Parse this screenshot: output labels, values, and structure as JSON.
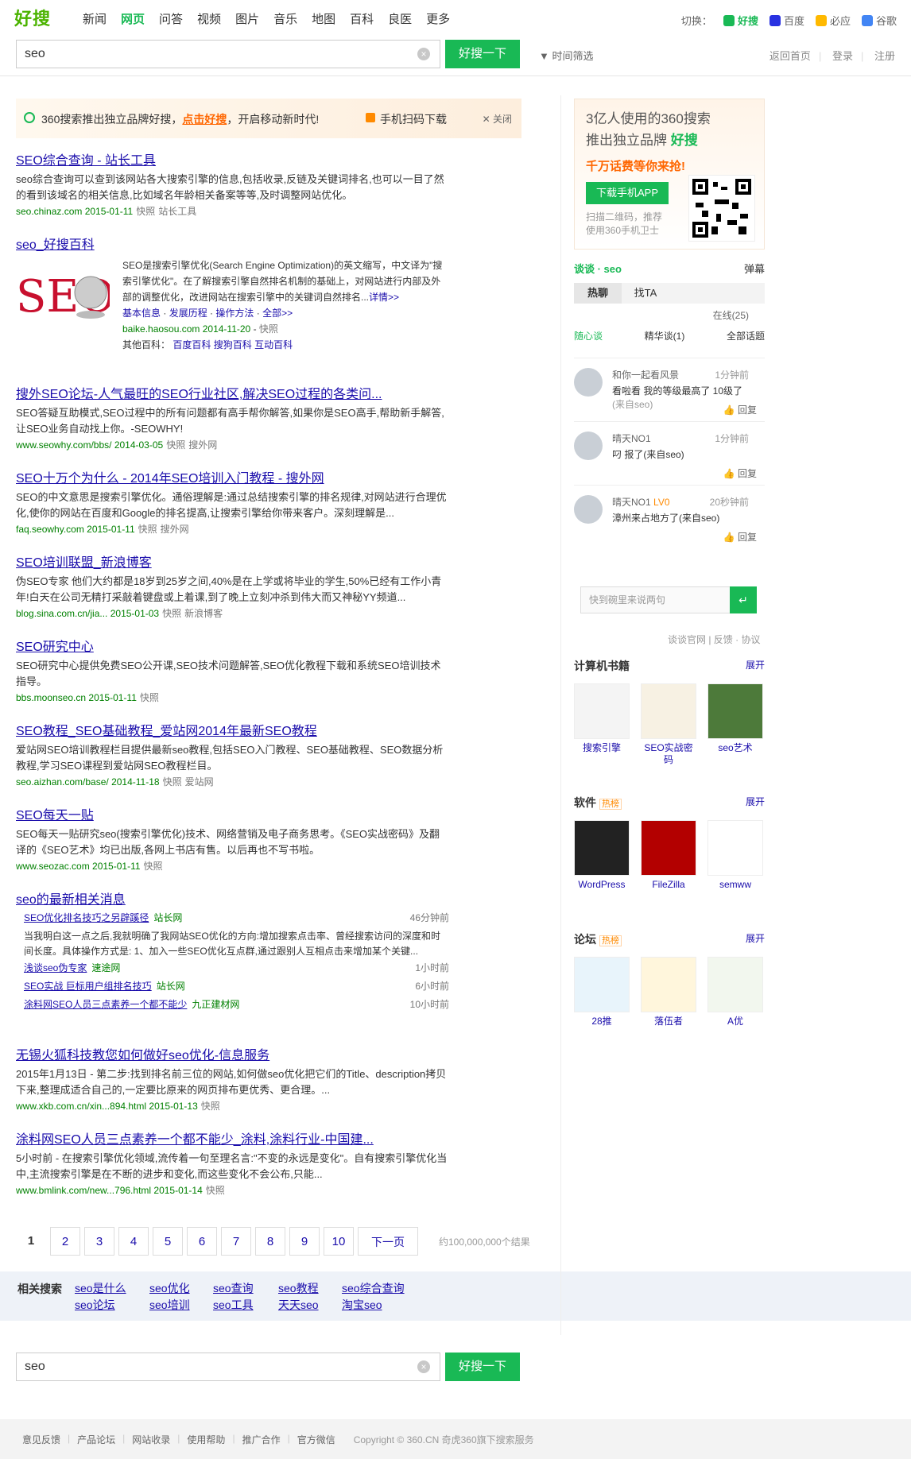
{
  "header": {
    "logo_text": "好搜",
    "nav": [
      "新闻",
      "网页",
      "问答",
      "视频",
      "图片",
      "音乐",
      "地图",
      "百科",
      "良医",
      "更多"
    ],
    "switch_label": "切换：",
    "engines": [
      {
        "name": "好搜",
        "color": "#19b955"
      },
      {
        "name": "百度",
        "color": "#2932e1"
      },
      {
        "name": "必应",
        "color": "#ffb900"
      },
      {
        "name": "谷歌",
        "color": "#4285f4"
      }
    ],
    "query": "seo",
    "search_button": "好搜一下",
    "time_filter": "时间筛选",
    "links": [
      "返回首页",
      "登录",
      "注册"
    ]
  },
  "promo": {
    "prefix": "360搜索推出独立品牌好搜，",
    "link": "点击好搜",
    "suffix": "，开启移动新时代!",
    "download": "手机扫码下载",
    "close": "关闭"
  },
  "results": [
    {
      "title": "SEO综合查询 - 站长工具",
      "desc": "seo综合查询可以查到该网站各大搜索引擎的信息,包括收录,反链及关键词排名,也可以一目了然的看到该域名的相关信息,比如域名年龄相关备案等等,及时调整网站优化。",
      "url": "seo.chinaz.com 2015-01-11",
      "links": [
        "快照",
        "站长工具"
      ]
    },
    {
      "title": "SEO十万个为什么 - 2014年SEO培训入门教程 - 搜外网",
      "desc": "SEO的中文意思是搜索引擎优化。通俗理解是:通过总结搜索引擎的排名规律,对网站进行合理优化,使你的网站在百度和Google的排名提高,让搜索引擎给你带来客户。深刻理解是...",
      "url": "faq.seowhy.com 2015-01-11",
      "links": [
        "快照",
        "搜外网"
      ]
    },
    {
      "title": "SEO培训联盟_新浪博客",
      "desc": "伪SEO专家 他们大约都是18岁到25岁之间,40%是在上学或将毕业的学生,50%已经有工作小青年!白天在公司无精打采敲着键盘或上着课,到了晚上立刻冲杀到伟大而又神秘YY频道...",
      "url": "blog.sina.com.cn/jia... 2015-01-03",
      "links": [
        "快照",
        "新浪博客"
      ]
    },
    {
      "title": "SEO研究中心",
      "desc": "SEO研究中心提供免费SEO公开课,SEO技术问题解答,SEO优化教程下载和系统SEO培训技术指导。",
      "url": "bbs.moonseo.cn 2015-01-11",
      "links": [
        "快照"
      ]
    },
    {
      "title": "SEO教程_SEO基础教程_爱站网2014年最新SEO教程",
      "desc": "爱站网SEO培训教程栏目提供最新seo教程,包括SEO入门教程、SEO基础教程、SEO数据分析教程,学习SEO课程到爱站网SEO教程栏目。",
      "url": "seo.aizhan.com/base/ 2014-11-18",
      "links": [
        "快照",
        "爱站网"
      ]
    },
    {
      "title": "SEO每天一贴",
      "desc": "SEO每天一贴研究seo(搜索引擎优化)技术、网络营销及电子商务思考。《SEO实战密码》及翻译的《SEO艺术》均已出版,各网上书店有售。以后再也不写书啦。",
      "url": "www.seozac.com 2015-01-11",
      "links": [
        "快照"
      ]
    }
  ],
  "baike": {
    "title": "seo_好搜百科",
    "logo": "SEO",
    "desc": "SEO是搜索引擎优化(Search Engine Optimization)的英文缩写，中文译为\"搜索引擎优化\"。在了解搜索引擎自然排名机制的基础上，对网站进行内部及外部的调整优化，改进网站在搜索引擎中的关键词自然排名...",
    "more": "详情>>",
    "sub_links": [
      "基本信息",
      "发展历程",
      "操作方法",
      "全部>>"
    ],
    "url": "baike.haosou.com 2014-11-20",
    "snapshot": "快照",
    "other_label": "其他百科：",
    "other": [
      "百度百科",
      "搜狗百科",
      "互动百科"
    ]
  },
  "forum": {
    "title": "搜外SEO论坛-人气最旺的SEO行业社区,解决SEO过程的各类问...",
    "desc": "SEO答疑互助模式,SEO过程中的所有问题都有高手帮你解答,如果你是SEO高手,帮助新手解答,让SEO业务自动找上你。-SEOWHY!",
    "url": "www.seowhy.com/bbs/ 2014-03-05",
    "links": [
      "快照",
      "搜外网"
    ]
  },
  "news": {
    "title": "seo的最新相关消息",
    "items": [
      {
        "t": "SEO优化排名技巧之另辟蹊径",
        "s": "站长网",
        "tm": "46分钟前"
      },
      {
        "t": "浅谈seo伪专家",
        "s": "速途网",
        "tm": "1小时前"
      },
      {
        "t": "SEO实战 巨标用户组排名技巧",
        "s": "站长网",
        "tm": "6小时前"
      },
      {
        "t": "涂料网SEO人员三点素养一个都不能少",
        "s": "九正建材网",
        "tm": "10小时前"
      }
    ],
    "lead": "当我明白这一点之后,我就明确了我网站SEO优化的方向:增加搜索点击率、曾经搜索访问的深度和时间长度。具体操作方式是: 1、加入一些SEO优化互点群,通过跟别人互相点击来增加某个关键..."
  },
  "result_xkb": {
    "title": "无锡火狐科技教您如何做好seo优化-信息服务",
    "desc": "2015年1月13日 - 第二步:找到排名前三位的网站,如何做seo优化把它们的Title、description拷贝下来,整理成适合自己的,一定要比原来的网页排布更优秀、更合理。...",
    "url": "www.xkb.com.cn/xin...894.html 2015-01-13",
    "links": [
      "快照"
    ]
  },
  "result_bm": {
    "title": "涂料网SEO人员三点素养一个都不能少_涂料,涂料行业-中国建...",
    "desc": "5小时前 - 在搜索引擎优化领域,流传着一句至理名言:\"不变的永远是变化\"。自有搜索引擎优化当中,主流搜索引擎是在不断的进步和变化,而这些变化不会公布,只能...",
    "url": "www.bmlink.com/new...796.html 2015-01-14",
    "links": [
      "快照"
    ]
  },
  "pager": {
    "pages": [
      "1",
      "2",
      "3",
      "4",
      "5",
      "6",
      "7",
      "8",
      "9",
      "10"
    ],
    "next": "下一页",
    "count": "约100,000,000个结果"
  },
  "related": {
    "label": "相关搜索",
    "items": [
      "seo是什么",
      "seo优化",
      "seo查询",
      "seo教程",
      "seo综合查询",
      "seo论坛",
      "seo培训",
      "seo工具",
      "天天seo",
      "淘宝seo"
    ]
  },
  "footer": {
    "links": [
      "意见反馈",
      "产品论坛",
      "网站收录",
      "使用帮助",
      "推广合作",
      "官方微信"
    ],
    "copyright": "Copyright © 360.CN 奇虎360旗下搜索服务"
  },
  "side": {
    "ad": {
      "l1": "3亿人使用的360搜索",
      "l2": "推出独立品牌",
      "brand": "好搜",
      "l3": "千万话费等你来抢!",
      "btn": "下载手机APP",
      "sub1": "扫描二维码，推荐",
      "sub2": "使用360手机卫士"
    },
    "chat": {
      "title": "谈谈 · seo",
      "danmu": "弹幕",
      "tabs": [
        "热聊",
        "找TA"
      ],
      "online": "在线(25)",
      "subtabs": [
        "随心谈",
        "精华谈(1)",
        "全部话题"
      ],
      "posts": [
        {
          "name": "和你一起看风景",
          "time": "1分钟前",
          "content": "看啦看 我的等级最高了 10级了",
          "from": "(来自seo)",
          "reply": "回复"
        },
        {
          "name": "晴天NO1",
          "time": "1分钟前",
          "content": "叼 报了(来自seo)",
          "from": "",
          "reply": "回复"
        },
        {
          "name": "晴天NO1",
          "level": "LV0",
          "time": "20秒钟前",
          "content": "漳州来占地方了(来自seo)",
          "from": "",
          "reply": "回复"
        }
      ],
      "input": "快到碗里来说两句",
      "links": "谈谈官网 | 反馈 · 协议"
    },
    "mods": [
      {
        "title": "计算机书籍",
        "hot": "",
        "expand": "展开",
        "items": [
          "搜索引擎",
          "SEO实战密码",
          "seo艺术"
        ]
      },
      {
        "title": "软件",
        "hot": "热榜",
        "expand": "展开",
        "items": [
          "WordPress",
          "FileZilla",
          "semww"
        ]
      },
      {
        "title": "论坛",
        "hot": "热榜",
        "expand": "展开",
        "items": [
          "28推",
          "落伍者",
          "A优"
        ]
      }
    ]
  }
}
